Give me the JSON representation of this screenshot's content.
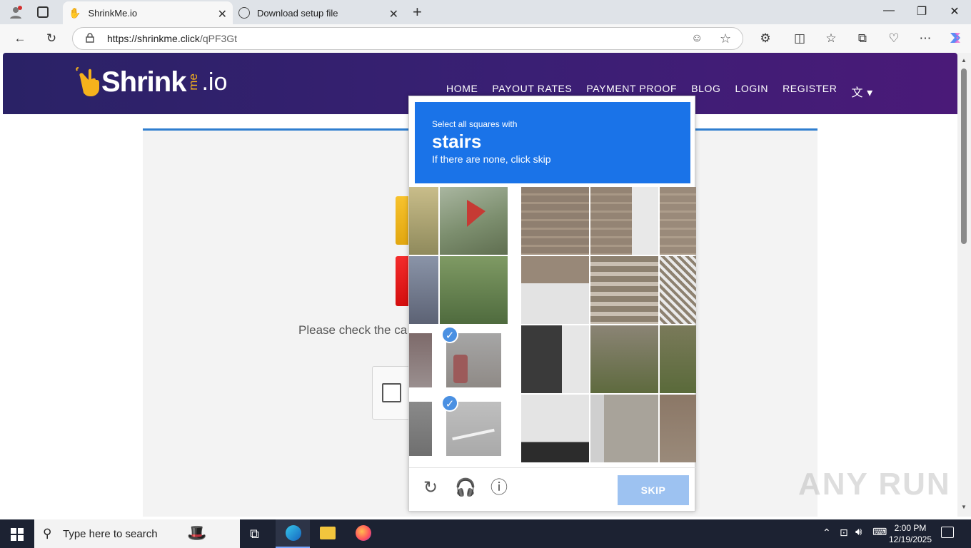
{
  "browser": {
    "tabs": [
      {
        "title": "ShrinkMe.io",
        "active": true
      },
      {
        "title": "Download setup file",
        "active": false
      }
    ],
    "url_host": "https://shrinkme.click",
    "url_path": "/qPF3Gt"
  },
  "site": {
    "logo_word": "Shrink",
    "logo_me": "me",
    "logo_io": ".io",
    "nav": [
      "HOME",
      "PAYOUT RATES",
      "PAYMENT PROOF",
      "BLOG",
      "LOGIN",
      "REGISTER"
    ],
    "check_text": "Please check the ca"
  },
  "captcha": {
    "line1": "Select all squares with",
    "keyword": "stairs",
    "line3": "If there are none, click skip",
    "skip_label": "SKIP",
    "selected_count": 2
  },
  "taskbar": {
    "search_placeholder": "Type here to search",
    "time": "2:00 PM",
    "date": "12/19/2025"
  },
  "watermark": "ANY RUN",
  "colors": {
    "captcha_blue": "#1a73e8",
    "header_purple": "#3a1f74",
    "accent_yellow": "#f6b21c"
  }
}
